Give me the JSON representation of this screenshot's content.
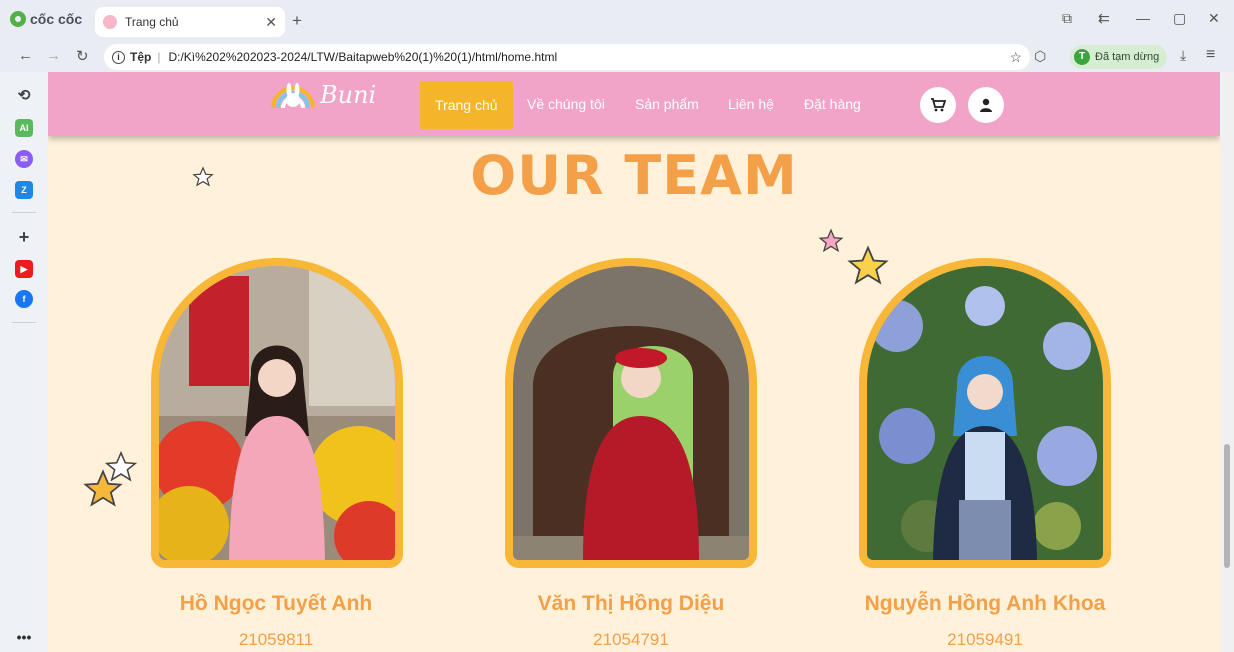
{
  "browser": {
    "brand_name": "cốc cốc",
    "tab_title": "Trang chủ",
    "omnibox_label": "Tệp",
    "url": "D:/Kì%202%202023-2024/LTW/Baitapweb%20(1)%20(1)/html/home.html",
    "profile_initial": "T",
    "profile_status": "Đã tạm dừng"
  },
  "site": {
    "logo_text": "Buni",
    "menu": [
      "Trang chủ",
      "Về chúng tôi",
      "Sản phẩm",
      "Liên hệ",
      "Đặt hàng"
    ],
    "heading": "OUR TEAM",
    "members": [
      {
        "name": "Hồ Ngọc Tuyết Anh",
        "id": "21059811"
      },
      {
        "name": "Văn Thị Hồng Diệu",
        "id": "21054791"
      },
      {
        "name": "Nguyễn Hồng Anh Khoa",
        "id": "21059491"
      }
    ]
  },
  "colors": {
    "nav_pink": "#f2a3c8",
    "active_yellow": "#f4b52a",
    "heading_orange": "#f4a048",
    "frame_yellow": "#f9b737",
    "page_cream": "#fff1da"
  }
}
